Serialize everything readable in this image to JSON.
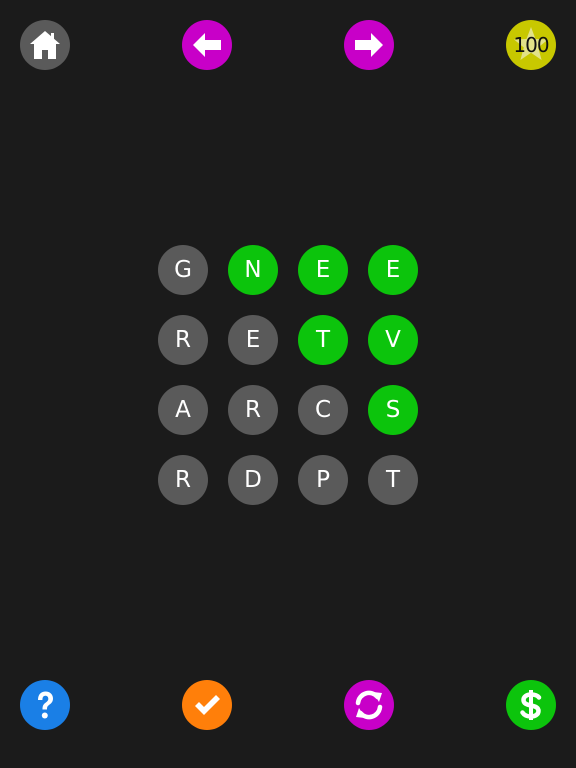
{
  "colors": {
    "background": "#1b1b1b",
    "tile_default": "#5a5a5a",
    "tile_selected": "#0cc40c",
    "home": "#5a5a5a",
    "nav": "#c800c8",
    "score": "#c8c800",
    "help": "#1a7fe6",
    "submit": "#ff7f0a",
    "shuffle": "#c800c8",
    "shop": "#0cc40c"
  },
  "icons": {
    "home": "home-icon",
    "back": "arrow-left-icon",
    "forward": "arrow-right-icon",
    "score": "star-icon",
    "help": "question-mark-icon",
    "submit": "checkmark-icon",
    "shuffle": "refresh-icon",
    "shop": "dollar-icon"
  },
  "score": "100",
  "grid": {
    "rows": [
      [
        {
          "letter": "G",
          "selected": false
        },
        {
          "letter": "N",
          "selected": true
        },
        {
          "letter": "E",
          "selected": true
        },
        {
          "letter": "E",
          "selected": true
        }
      ],
      [
        {
          "letter": "R",
          "selected": false
        },
        {
          "letter": "E",
          "selected": false
        },
        {
          "letter": "T",
          "selected": true
        },
        {
          "letter": "V",
          "selected": true
        }
      ],
      [
        {
          "letter": "A",
          "selected": false
        },
        {
          "letter": "R",
          "selected": false
        },
        {
          "letter": "C",
          "selected": false
        },
        {
          "letter": "S",
          "selected": true
        }
      ],
      [
        {
          "letter": "R",
          "selected": false
        },
        {
          "letter": "D",
          "selected": false
        },
        {
          "letter": "P",
          "selected": false
        },
        {
          "letter": "T",
          "selected": false
        }
      ]
    ]
  }
}
